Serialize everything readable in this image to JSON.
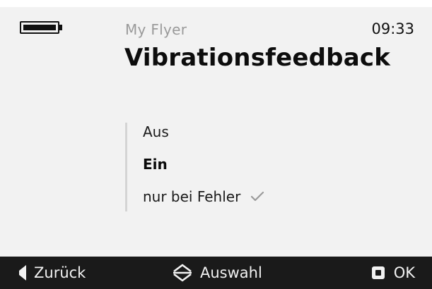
{
  "status": {
    "battery_level": 1.0,
    "battery_icon": "battery-icon",
    "app_name": "My Flyer",
    "time": "09:33"
  },
  "page": {
    "title": "Vibrationsfeedback"
  },
  "options": [
    {
      "label": "Aus",
      "selected": false,
      "checked": false
    },
    {
      "label": "Ein",
      "selected": true,
      "checked": false
    },
    {
      "label": "nur bei Fehler",
      "selected": false,
      "checked": true,
      "icon": "check-icon"
    }
  ],
  "bottom_bar": {
    "back_label": "Zurück",
    "back_icon": "back-arrow-icon",
    "select_label": "Auswahl",
    "select_icon": "up-down-icon",
    "ok_label": "OK",
    "ok_icon": "square-button-icon"
  },
  "colors": {
    "background": "#f2f2f2",
    "text": "#111111",
    "muted": "#9a9a9a",
    "bar": "#1a1a1a",
    "check": "#9a9a9a"
  }
}
